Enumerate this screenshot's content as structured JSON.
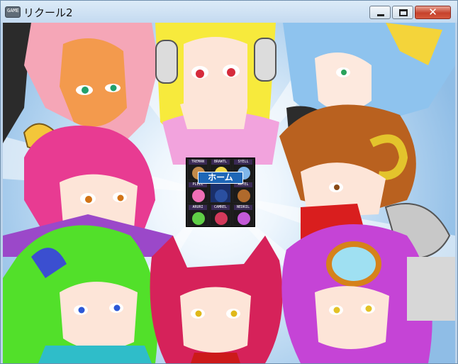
{
  "window": {
    "title": "リクール2",
    "icon": "game-app-icon",
    "icon_text": "GAME",
    "controls": {
      "minimize": "minimize-icon",
      "maximize": "maximize-icon",
      "close": "✕"
    }
  },
  "menu": {
    "home_label": "ホーム",
    "tiles": [
      {
        "id": "tile-1",
        "label": "TREMAN",
        "color": "#c28a4a"
      },
      {
        "id": "tile-2",
        "label": "BRAWTL",
        "color": "#f1d84a"
      },
      {
        "id": "tile-3",
        "label": "SYELL",
        "color": "#7fb6ea"
      },
      {
        "id": "tile-4",
        "label": "PLEEL",
        "color": "#f06fb6"
      },
      {
        "id": "tile-5",
        "label": "",
        "color": "#1a2f6a"
      },
      {
        "id": "tile-6",
        "label": "ARTEL",
        "color": "#b06a2c"
      },
      {
        "id": "tile-7",
        "label": "ARURI",
        "color": "#5fcf46"
      },
      {
        "id": "tile-8",
        "label": "CAMREL",
        "color": "#d2395a"
      },
      {
        "id": "tile-9",
        "label": "NEDRIL",
        "color": "#c45ad8"
      }
    ]
  }
}
